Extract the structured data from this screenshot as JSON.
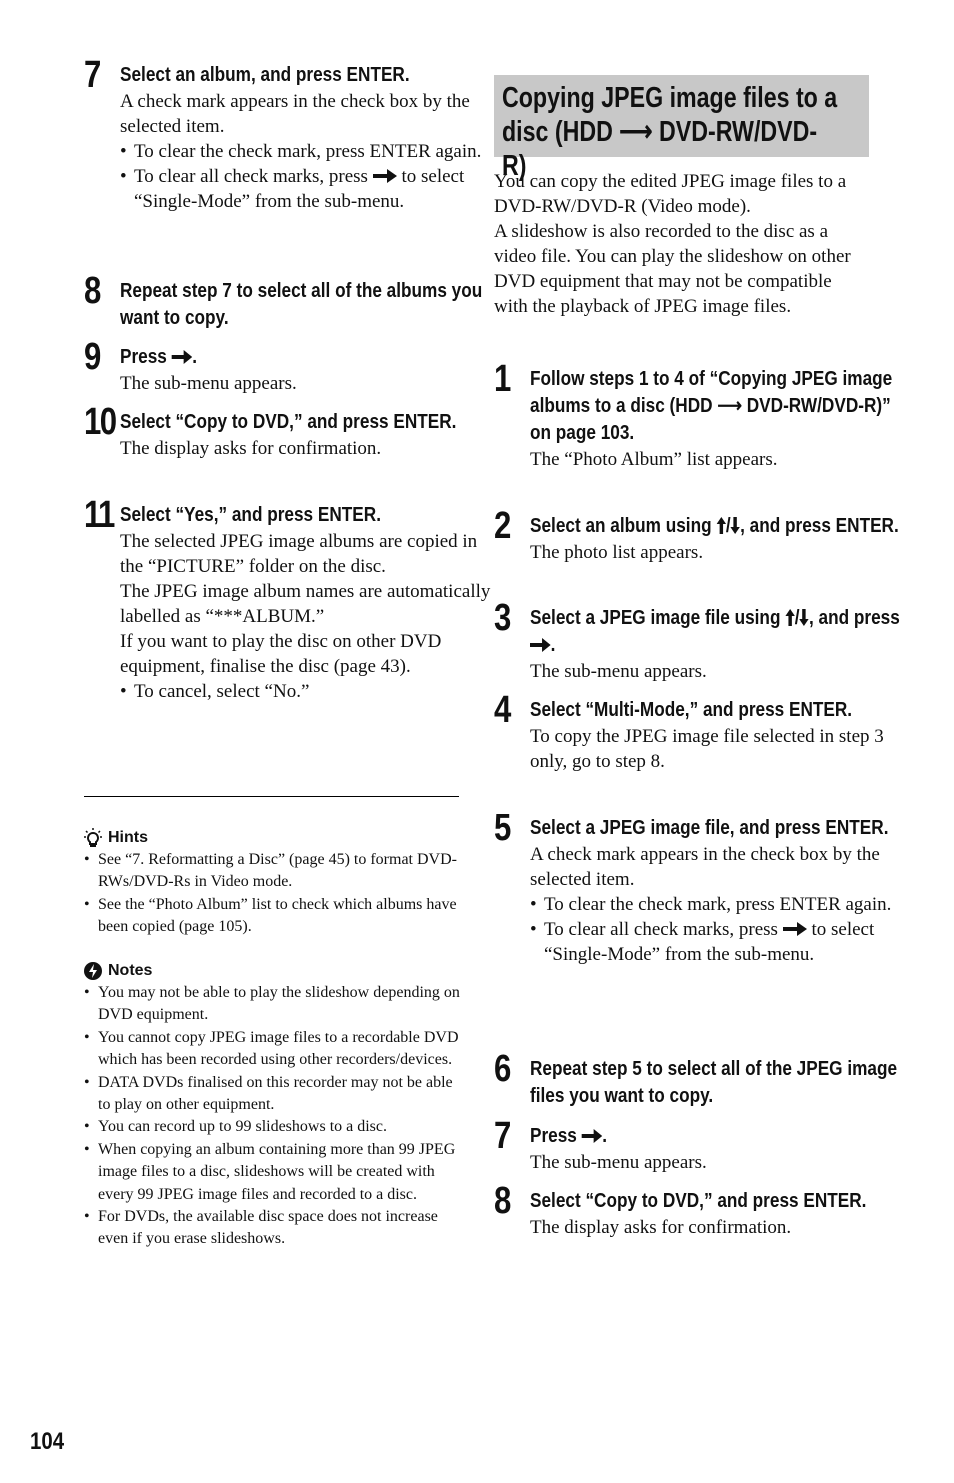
{
  "page_number": "104",
  "left_column": {
    "steps": [
      {
        "number": "7",
        "heading": "Select an album, and press ENTER.",
        "text": "A check mark appears in the check box by the selected item.",
        "bullets": [
          {
            "text": "To clear the check mark, press ENTER again."
          },
          {
            "before": "To clear all check marks, press",
            "icon": "right-arrow-icon",
            "after": "to select “Single-Mode” from the sub-menu."
          }
        ]
      },
      {
        "number": "8",
        "heading": "Repeat step 7 to select all of the albums you want to copy."
      },
      {
        "number": "9",
        "heading_before": "Press",
        "heading_icon": "right-arrow-icon",
        "heading_after": ".",
        "text": "The sub-menu appears."
      },
      {
        "number": "10",
        "heading": "Select “Copy to DVD,” and press ENTER.",
        "text": "The display asks for confirmation."
      },
      {
        "number": "11",
        "heading": "Select “Yes,” and press ENTER.",
        "paragraphs": [
          "The selected JPEG image albums are copied in the “PICTURE” folder on the disc.",
          "The JPEG image album names are automatically labelled as “***ALBUM.”",
          "If you want to play the disc on other DVD equipment, finalise the disc (page 43)."
        ],
        "bullets": [
          {
            "text": "To cancel, select “No.”"
          }
        ]
      }
    ],
    "hints": {
      "title": "Hints",
      "icon": "lightbulb-icon",
      "items": [
        "See “7. Reformatting a Disc” (page 45) to format DVD-RWs/DVD-Rs in Video mode.",
        "See the “Photo Album” list to check which albums have been copied (page 105)."
      ]
    },
    "notes": {
      "title": "Notes",
      "icon": "lightning-icon",
      "items": [
        "You may not be able to play the slideshow depending on DVD equipment.",
        "You cannot copy JPEG image files to a recordable DVD which has been recorded using other recorders/devices.",
        "DATA DVDs finalised on this recorder may not be able to play on other equipment.",
        "You can record up to 99 slideshows to a disc.",
        "When copying an album containing more than 99 JPEG image files to a disc, slideshows will be created with every 99 JPEG image files and recorded to a disc.",
        "For DVDs, the available disc space does not increase even if you erase slideshows."
      ]
    }
  },
  "right_column": {
    "section_title": "Copying JPEG image files to a disc (HDD ⟶ DVD-RW/DVD-R)",
    "intro": [
      "You can copy the edited JPEG image files to a DVD-RW/DVD-R (Video mode).",
      "A slideshow is also recorded to the disc as a video file. You can play the slideshow on other DVD equipment that may not be compatible with the playback of JPEG image files."
    ],
    "steps": [
      {
        "number": "1",
        "heading": "Follow steps 1 to 4 of “Copying JPEG image albums to a disc (HDD ⟶ DVD-RW/DVD-R)” on page 103.",
        "text": "The “Photo Album” list appears."
      },
      {
        "number": "2",
        "heading_before": "Select an album using",
        "heading_after": ", and press ENTER.",
        "text": "The photo list appears."
      },
      {
        "number": "3",
        "heading_before": "Select a JPEG image file using",
        "heading_middle": ", and press",
        "heading_after": ".",
        "text": "The sub-menu appears."
      },
      {
        "number": "4",
        "heading": "Select “Multi-Mode,” and press ENTER.",
        "text": "To copy the JPEG image file selected in step 3 only, go to step 8."
      },
      {
        "number": "5",
        "heading": "Select a JPEG image file, and press ENTER.",
        "text": "A check mark appears in the check box by the selected item.",
        "bullets": [
          {
            "text": "To clear the check mark, press ENTER again."
          },
          {
            "before": "To clear all check marks, press",
            "after": "to select “Single-Mode” from the sub-menu."
          }
        ]
      },
      {
        "number": "6",
        "heading": "Repeat step 5 to select all of the JPEG image files you want to copy."
      },
      {
        "number": "7",
        "heading_before": "Press",
        "heading_after": ".",
        "text": "The sub-menu appears."
      },
      {
        "number": "8",
        "heading": "Select “Copy to DVD,” and press ENTER.",
        "text": "The display asks for confirmation."
      }
    ]
  }
}
